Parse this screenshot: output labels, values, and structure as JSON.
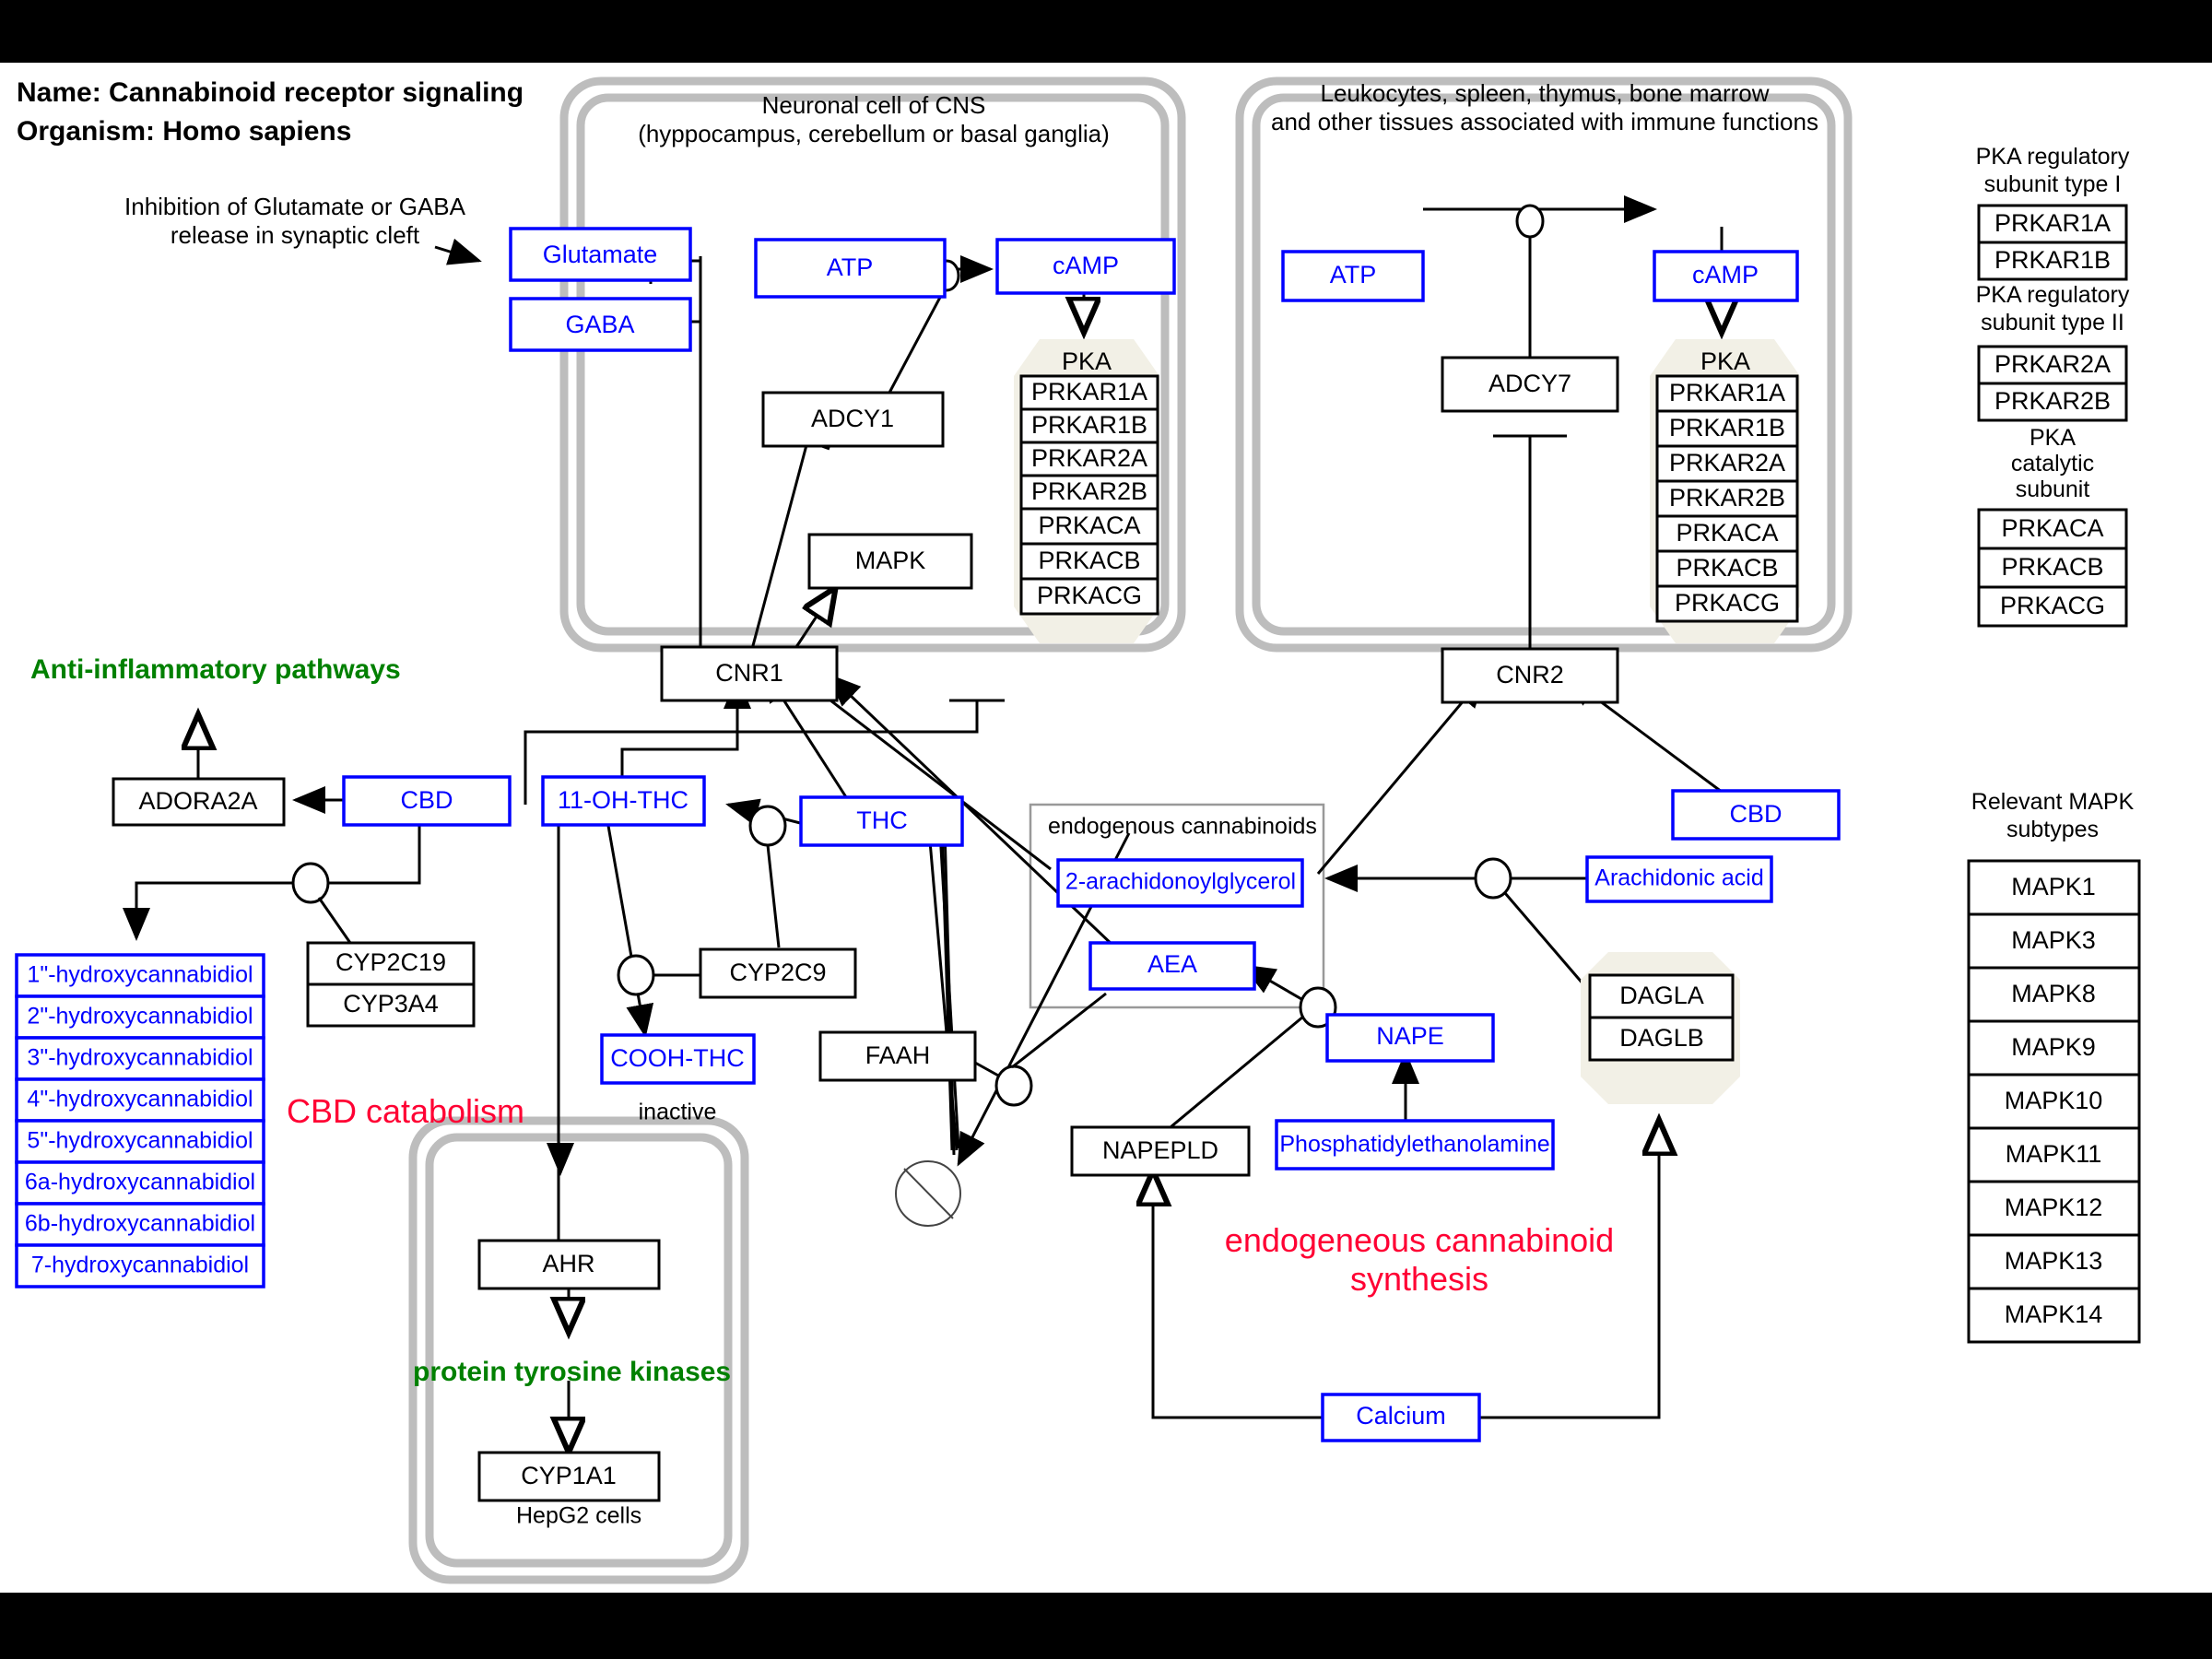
{
  "header": {
    "name_line": "Name: Cannabinoid receptor signaling",
    "organism_line": "Organism: Homo sapiens",
    "inhibition_note_1": "Inhibition of Glutamate or GABA",
    "inhibition_note_2": "release in synaptic cleft"
  },
  "compartments": {
    "neuron": {
      "title_1": "Neuronal cell of CNS",
      "title_2": "(hyppocampus, cerebellum or basal ganglia)"
    },
    "immune": {
      "title_1": "Leukocytes, spleen, thymus, bone marrow",
      "title_2": "and other tissues associated with immune functions"
    },
    "hepg2": {
      "label": "HepG2 cells"
    },
    "endo": {
      "label": "endogenous cannabinoids"
    }
  },
  "nodes": {
    "glutamate": "Glutamate",
    "gaba": "GABA",
    "atp_left": "ATP",
    "camp_left": "cAMP",
    "adcy1": "ADCY1",
    "mapk": "MAPK",
    "cnr1": "CNR1",
    "atp_right": "ATP",
    "camp_right": "cAMP",
    "adcy7": "ADCY7",
    "cnr2": "CNR2",
    "adora2a": "ADORA2A",
    "cbd_left": "CBD",
    "cbd_right": "CBD",
    "thc": "THC",
    "oh_thc": "11-OH-THC",
    "cooh_thc": "COOH-THC",
    "cooh_thc_note": "inactive",
    "cyp2c19": "CYP2C19",
    "cyp3a4": "CYP3A4",
    "cyp2c9": "CYP2C9",
    "faah": "FAAH",
    "ag2": "2-arachidonoylglycerol",
    "aea": "AEA",
    "arachidonic": "Arachidonic acid",
    "nape": "NAPE",
    "napepld": "NAPEPLD",
    "pe": "Phosphatidylethanolamine",
    "dagla": "DAGLA",
    "daglb": "DAGLB",
    "calcium": "Calcium",
    "ahr": "AHR",
    "cyp1a1": "CYP1A1",
    "ptk": "protein tyrosine kinases"
  },
  "annotations": {
    "anti_inflammatory": "Anti-inflammatory pathways",
    "cbd_catabolism": "CBD catabolism",
    "endo_synthesis_1": "endogeneous cannabinoid",
    "endo_synthesis_2": "synthesis"
  },
  "pka_complex": {
    "title": "PKA",
    "members": [
      "PRKAR1A",
      "PRKAR1B",
      "PRKAR2A",
      "PRKAR2B",
      "PRKACA",
      "PRKACB",
      "PRKACG"
    ]
  },
  "metabolites_list": [
    "1\"-hydroxycannabidiol",
    "2\"-hydroxycannabidiol",
    "3\"-hydroxycannabidiol",
    "4\"-hydroxycannabidiol",
    "5\"-hydroxycannabidiol",
    "6a-hydroxycannabidiol",
    "6b-hydroxycannabidiol",
    "7-hydroxycannabidiol"
  ],
  "legend": {
    "pka_reg_type1": {
      "title_1": "PKA regulatory",
      "title_2": "subunit type I",
      "items": [
        "PRKAR1A",
        "PRKAR1B"
      ]
    },
    "pka_reg_type2": {
      "title_1": "PKA regulatory",
      "title_2": "subunit type II",
      "items": [
        "PRKAR2A",
        "PRKAR2B"
      ]
    },
    "pka_catalytic": {
      "title_1": "PKA",
      "title_2": "catalytic",
      "title_3": "subunit",
      "items": [
        "PRKACA",
        "PRKACB",
        "PRKACG"
      ]
    },
    "mapk": {
      "title_1": "Relevant MAPK",
      "title_2": "subtypes",
      "items": [
        "MAPK1",
        "MAPK3",
        "MAPK8",
        "MAPK9",
        "MAPK10",
        "MAPK11",
        "MAPK12",
        "MAPK13",
        "MAPK14"
      ]
    }
  },
  "colors": {
    "metabolite": "#0000ff",
    "protein": "#000000",
    "annotation_green": "#008000",
    "annotation_red": "#ff0033",
    "compartment": "#bdbdbd",
    "complex_bg": "#f2f0e6"
  }
}
